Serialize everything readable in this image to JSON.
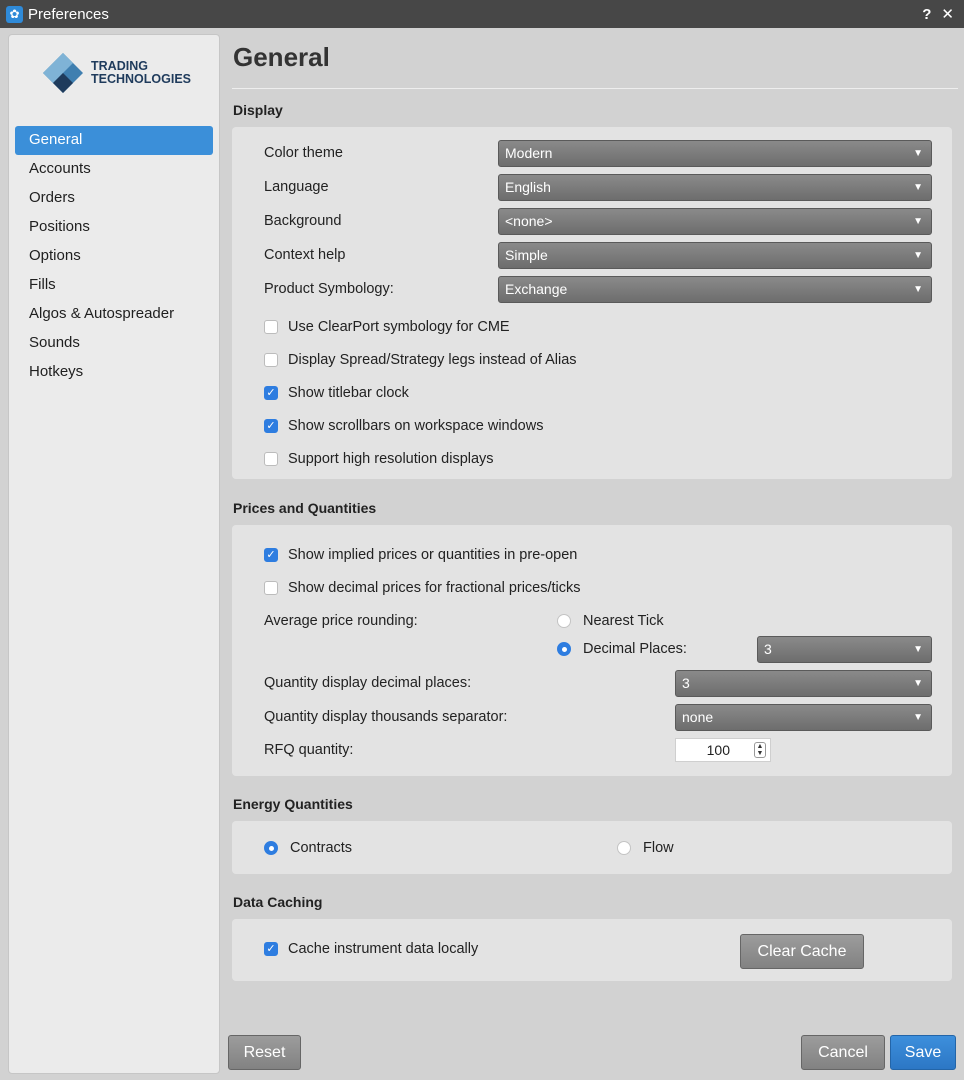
{
  "window": {
    "title": "Preferences",
    "help_label": "?",
    "close_label": "✕"
  },
  "logo": {
    "line1": "TRADING",
    "line2": "TECHNOLOGIES"
  },
  "sidebar": {
    "items": [
      {
        "label": "General",
        "active": true
      },
      {
        "label": "Accounts"
      },
      {
        "label": "Orders"
      },
      {
        "label": "Positions"
      },
      {
        "label": "Options"
      },
      {
        "label": "Fills"
      },
      {
        "label": "Algos & Autospreader"
      },
      {
        "label": "Sounds"
      },
      {
        "label": "Hotkeys"
      }
    ]
  },
  "main": {
    "title": "General",
    "display": {
      "heading": "Display",
      "color_theme": {
        "label": "Color theme",
        "value": "Modern"
      },
      "language": {
        "label": "Language",
        "value": "English"
      },
      "background": {
        "label": "Background",
        "value": "<none>"
      },
      "context_help": {
        "label": "Context help",
        "value": "Simple"
      },
      "product_symbology": {
        "label": "Product Symbology:",
        "value": "Exchange"
      },
      "checks": [
        {
          "label": "Use ClearPort symbology for CME",
          "checked": false
        },
        {
          "label": "Display Spread/Strategy legs instead of Alias",
          "checked": false
        },
        {
          "label": "Show titlebar clock",
          "checked": true
        },
        {
          "label": "Show scrollbars on workspace windows",
          "checked": true
        },
        {
          "label": "Support high resolution displays",
          "checked": false
        }
      ]
    },
    "prices": {
      "heading": "Prices and Quantities",
      "checks": [
        {
          "label": "Show implied prices or quantities in pre-open",
          "checked": true
        },
        {
          "label": "Show decimal prices for fractional prices/ticks",
          "checked": false
        }
      ],
      "avg_rounding_label": "Average price rounding:",
      "nearest_tick_label": "Nearest Tick",
      "decimal_places_label": "Decimal Places:",
      "decimal_places_value": "3",
      "qty_decimals": {
        "label": "Quantity display decimal places:",
        "value": "3"
      },
      "qty_separator": {
        "label": "Quantity display thousands separator:",
        "value": "none"
      },
      "rfq": {
        "label": "RFQ quantity:",
        "value": "100"
      }
    },
    "energy": {
      "heading": "Energy Quantities",
      "contracts_label": "Contracts",
      "flow_label": "Flow"
    },
    "caching": {
      "heading": "Data Caching",
      "cache_label": "Cache instrument data locally",
      "clear_label": "Clear Cache"
    }
  },
  "footer": {
    "reset": "Reset",
    "cancel": "Cancel",
    "save": "Save"
  },
  "colors": {
    "accent": "#3b8fd9",
    "panel": "#e3e3e3",
    "window": "#d2d2d2"
  }
}
